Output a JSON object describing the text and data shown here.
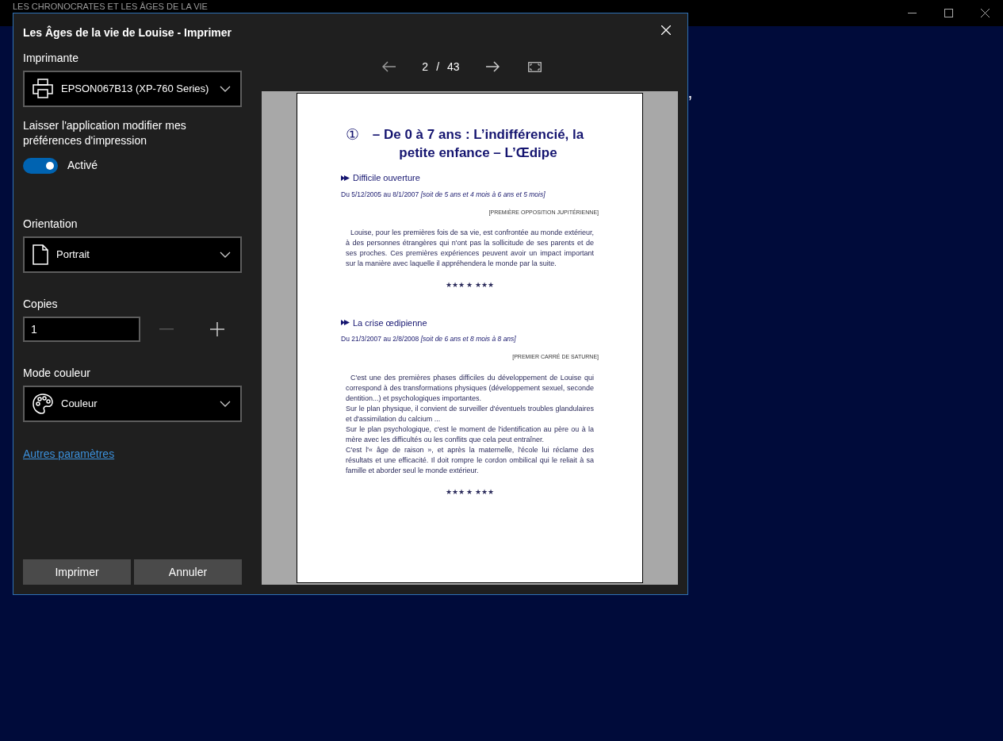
{
  "app": {
    "title": "LES CHRONOCRATES ET LES ÂGES DE LA VIE",
    "background_text": "’"
  },
  "dialog": {
    "title": "Les Âges de la vie de Louise - Imprimer",
    "settings": [
      {
        "kind": "dropdown",
        "label": "Imprimante",
        "value": "EPSON067B13 (XP-760 Series)"
      },
      {
        "kind": "toggle",
        "label": "Laisser l'application modifier mes préférences d'impression",
        "on": true,
        "state_text": "Activé"
      },
      {
        "kind": "dropdown",
        "label": "Orientation",
        "value": "Portrait"
      },
      {
        "kind": "stepper",
        "label": "Copies",
        "value": "1",
        "minus_disabled": true
      },
      {
        "kind": "dropdown",
        "label": "Mode couleur",
        "value": "Couleur"
      }
    ],
    "more_link": "Autres paramètres",
    "buttons": [
      "Imprimer",
      "Annuler"
    ],
    "preview": {
      "page_current": "2",
      "separator": "/",
      "page_total": "43",
      "document": {
        "title_number": "①",
        "title": "– De 0 à 7 ans : L’indifférencié, la petite enfance – L’Œdipe",
        "sections": [
          {
            "heading": "Difficile ouverture",
            "dates": "Du 5/12/2005 au 8/1/2007",
            "dates_note": "[soit de 5 ans et 4 mois à 6 ans et 5 mois]",
            "tag": "[PREMIÈRE OPPOSITION JUPITÉRIENNE]",
            "paragraphs": [
              "Louise, pour les premières fois de sa vie, est confrontée au monde extérieur, à des personnes étrangères qui n'ont pas la sollicitude de ses parents et de ses proches. Ces premières expériences peuvent avoir un impact important sur la manière avec laquelle il appréhendera le monde par la suite."
            ],
            "separator": "★★★ ★ ★★★"
          },
          {
            "heading": "La crise œdipienne",
            "dates": "Du 21/3/2007 au 2/8/2008",
            "dates_note": "[soit de 6 ans et 8 mois à 8 ans]",
            "tag": "[PREMIER CARRÉ DE SATURNE]",
            "paragraphs": [
              "C'est une des premières phases difficiles du développement de Louise qui correspond à des transformations physiques (développement sexuel, seconde dentition...) et psychologiques importantes.",
              "Sur le plan physique, il convient de surveiller d'éventuels troubles glandulaires et d'assimilation du calcium ...",
              "Sur le plan psychologique, c'est le moment de l'identification au père ou à la mère avec les difficultés ou les conflits que cela peut entraîner.",
              "C'est l'« âge de raison », et après la maternelle, l'école lui réclame des résultats et une efficacité. Il doit rompre le cordon ombilical qui le reliait à sa famille et aborder seul le monde extérieur."
            ],
            "separator": "★★★ ★ ★★★"
          }
        ]
      }
    }
  }
}
